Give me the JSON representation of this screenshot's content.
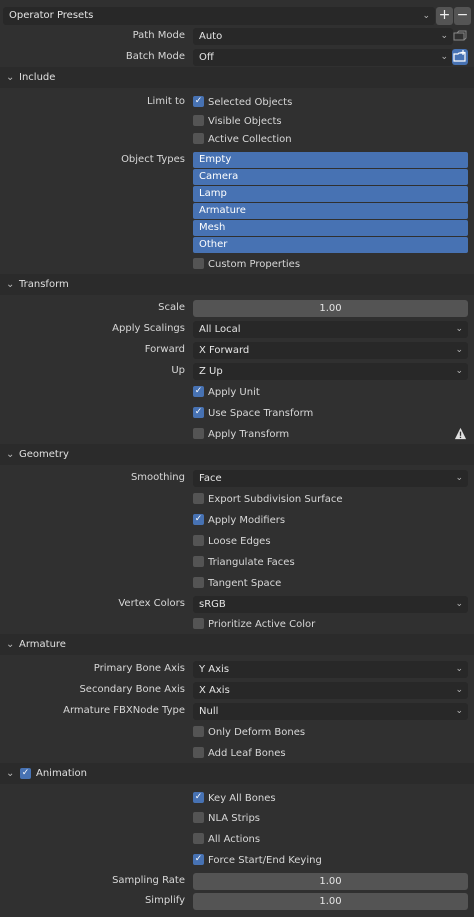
{
  "presets": {
    "label": "Operator Presets",
    "add": "+",
    "remove": "−"
  },
  "path_mode": {
    "label": "Path Mode",
    "value": "Auto"
  },
  "batch_mode": {
    "label": "Batch Mode",
    "value": "Off"
  },
  "include": {
    "title": "Include",
    "limit_to_label": "Limit to",
    "limit": [
      {
        "label": "Selected Objects",
        "checked": true
      },
      {
        "label": "Visible Objects",
        "checked": false
      },
      {
        "label": "Active Collection",
        "checked": false
      }
    ],
    "object_types_label": "Object Types",
    "object_types": [
      "Empty",
      "Camera",
      "Lamp",
      "Armature",
      "Mesh",
      "Other"
    ],
    "custom_properties": {
      "label": "Custom Properties",
      "checked": false
    }
  },
  "transform": {
    "title": "Transform",
    "scale_label": "Scale",
    "scale_value": "1.00",
    "apply_scalings_label": "Apply Scalings",
    "apply_scalings_value": "All Local",
    "forward_label": "Forward",
    "forward_value": "X Forward",
    "up_label": "Up",
    "up_value": "Z Up",
    "apply_unit": {
      "label": "Apply Unit",
      "checked": true
    },
    "use_space_transform": {
      "label": "Use Space Transform",
      "checked": true
    },
    "apply_transform": {
      "label": "Apply Transform",
      "checked": false
    }
  },
  "geometry": {
    "title": "Geometry",
    "smoothing_label": "Smoothing",
    "smoothing_value": "Face",
    "checks": [
      {
        "label": "Export Subdivision Surface",
        "checked": false
      },
      {
        "label": "Apply Modifiers",
        "checked": true
      },
      {
        "label": "Loose Edges",
        "checked": false
      },
      {
        "label": "Triangulate Faces",
        "checked": false
      },
      {
        "label": "Tangent Space",
        "checked": false
      }
    ],
    "vertex_colors_label": "Vertex Colors",
    "vertex_colors_value": "sRGB",
    "prioritize": {
      "label": "Prioritize Active Color",
      "checked": false
    }
  },
  "armature": {
    "title": "Armature",
    "primary_label": "Primary Bone Axis",
    "primary_value": "Y Axis",
    "secondary_label": "Secondary Bone Axis",
    "secondary_value": "X Axis",
    "fbx_node_label": "Armature FBXNode Type",
    "fbx_node_value": "Null",
    "only_deform": {
      "label": "Only Deform Bones",
      "checked": false
    },
    "add_leaf": {
      "label": "Add Leaf Bones",
      "checked": false
    }
  },
  "animation": {
    "title": "Animation",
    "enabled": true,
    "checks": [
      {
        "label": "Key All Bones",
        "checked": true
      },
      {
        "label": "NLA Strips",
        "checked": false
      },
      {
        "label": "All Actions",
        "checked": false
      },
      {
        "label": "Force Start/End Keying",
        "checked": true
      }
    ],
    "sampling_rate_label": "Sampling Rate",
    "sampling_rate_value": "1.00",
    "simplify_label": "Simplify",
    "simplify_value": "1.00"
  },
  "colors": {
    "accent": "#4772b3",
    "panel": "#303030",
    "field": "#282828",
    "button": "#545454"
  }
}
